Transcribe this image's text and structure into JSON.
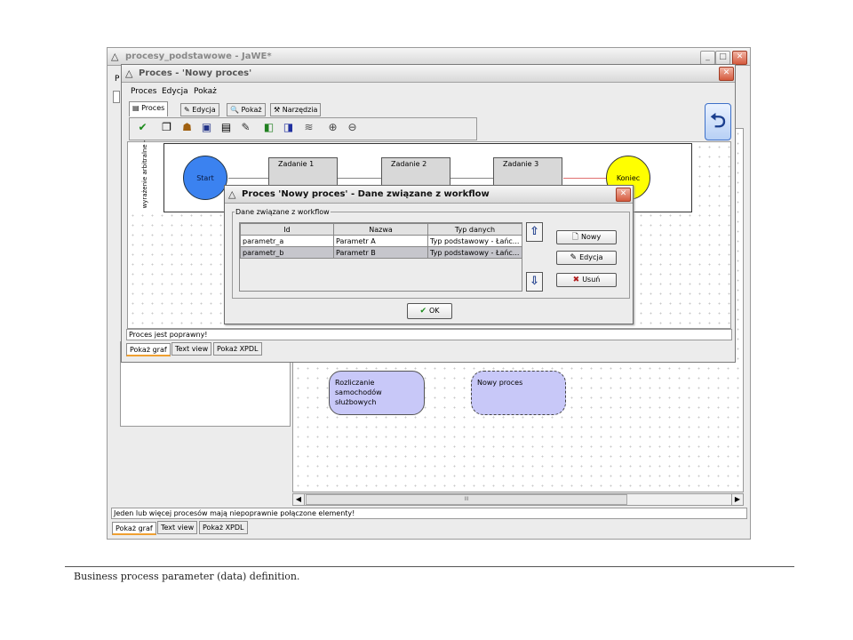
{
  "main_window": {
    "title": "procesy_podstawowe - JaWE*",
    "menu_letter": "P",
    "status": "Jeden lub więcej procesów mają niepoprawnie połączone elementy!",
    "bottom_tabs": [
      "Pokaż graf",
      "Text view",
      "Pokaż XPDL"
    ],
    "processes": [
      {
        "name": "Rozliczanie samochodów służbowych"
      },
      {
        "name": "Nowy proces"
      }
    ],
    "scroll_grip": "III"
  },
  "process_window": {
    "title": "Proces - 'Nowy proces'",
    "menu": [
      "Proces",
      "Edycja",
      "Pokaż"
    ],
    "tabs": [
      "Proces",
      "Edycja",
      "Pokaż",
      "Narzędzia"
    ],
    "lane_label": "wyrażenie arbitralne -",
    "graph": {
      "start": "Start",
      "tasks": [
        "Zadanie 1",
        "Zadanie 2",
        "Zadanie 3"
      ],
      "end": "Koniec"
    },
    "status": "Proces jest poprawny!",
    "bottom_tabs": [
      "Pokaż graf",
      "Text view",
      "Pokaż XPDL"
    ],
    "colors": {
      "start": "#3b82f0",
      "end": "#ffff00"
    }
  },
  "dialog": {
    "title": "Proces 'Nowy proces' - Dane związane z workflow",
    "group_label": "Dane związane z workflow",
    "columns": [
      "Id",
      "Nazwa",
      "Typ danych"
    ],
    "rows": [
      [
        "parametr_a",
        "Parametr A",
        "Typ podstawowy - Łańc..."
      ],
      [
        "parametr_b",
        "Parametr B",
        "Typ podstawowy - Łańc..."
      ]
    ],
    "buttons": {
      "new": "Nowy",
      "edit": "Edycja",
      "delete": "Usuń",
      "ok": "OK"
    }
  },
  "caption": "Business process parameter (data) definition."
}
